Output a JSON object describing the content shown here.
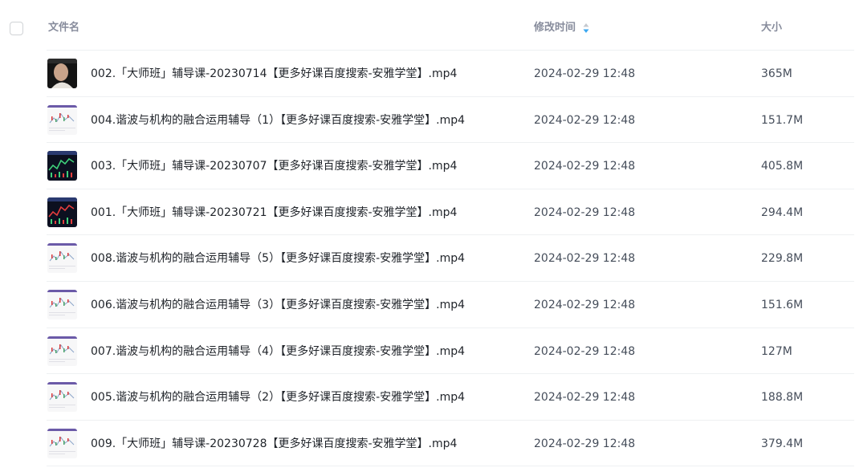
{
  "header": {
    "name_label": "文件名",
    "time_label": "修改时间",
    "size_label": "大小"
  },
  "sort": {
    "column": "time",
    "active_color": "#3aa7f0",
    "inactive_color": "#c4c8cf"
  },
  "files": [
    {
      "name": "002.「大师班」辅导课-20230714【更多好课百度搜索-安雅学堂】.mp4",
      "time": "2024-02-29 12:48",
      "size": "365M",
      "thumb": "portrait"
    },
    {
      "name": "004.谐波与机构的融合运用辅导（1）【更多好课百度搜索-安雅学堂】.mp4",
      "time": "2024-02-29 12:48",
      "size": "151.7M",
      "thumb": "light-chart"
    },
    {
      "name": "003.「大师班」辅导课-20230707【更多好课百度搜索-安雅学堂】.mp4",
      "time": "2024-02-29 12:48",
      "size": "405.8M",
      "thumb": "dark-chart"
    },
    {
      "name": "001.「大师班」辅导课-20230721【更多好课百度搜索-安雅学堂】.mp4",
      "time": "2024-02-29 12:48",
      "size": "294.4M",
      "thumb": "dark-chart-red"
    },
    {
      "name": "008.谐波与机构的融合运用辅导（5）【更多好课百度搜索-安雅学堂】.mp4",
      "time": "2024-02-29 12:48",
      "size": "229.8M",
      "thumb": "light-chart"
    },
    {
      "name": "006.谐波与机构的融合运用辅导（3）【更多好课百度搜索-安雅学堂】.mp4",
      "time": "2024-02-29 12:48",
      "size": "151.6M",
      "thumb": "light-chart"
    },
    {
      "name": "007.谐波与机构的融合运用辅导（4）【更多好课百度搜索-安雅学堂】.mp4",
      "time": "2024-02-29 12:48",
      "size": "127M",
      "thumb": "light-chart"
    },
    {
      "name": "005.谐波与机构的融合运用辅导（2）【更多好课百度搜索-安雅学堂】.mp4",
      "time": "2024-02-29 12:48",
      "size": "188.8M",
      "thumb": "light-chart-red"
    },
    {
      "name": "009.「大师班」辅导课-20230728【更多好课百度搜索-安雅学堂】.mp4",
      "time": "2024-02-29 12:48",
      "size": "379.4M",
      "thumb": "light-chart"
    }
  ]
}
